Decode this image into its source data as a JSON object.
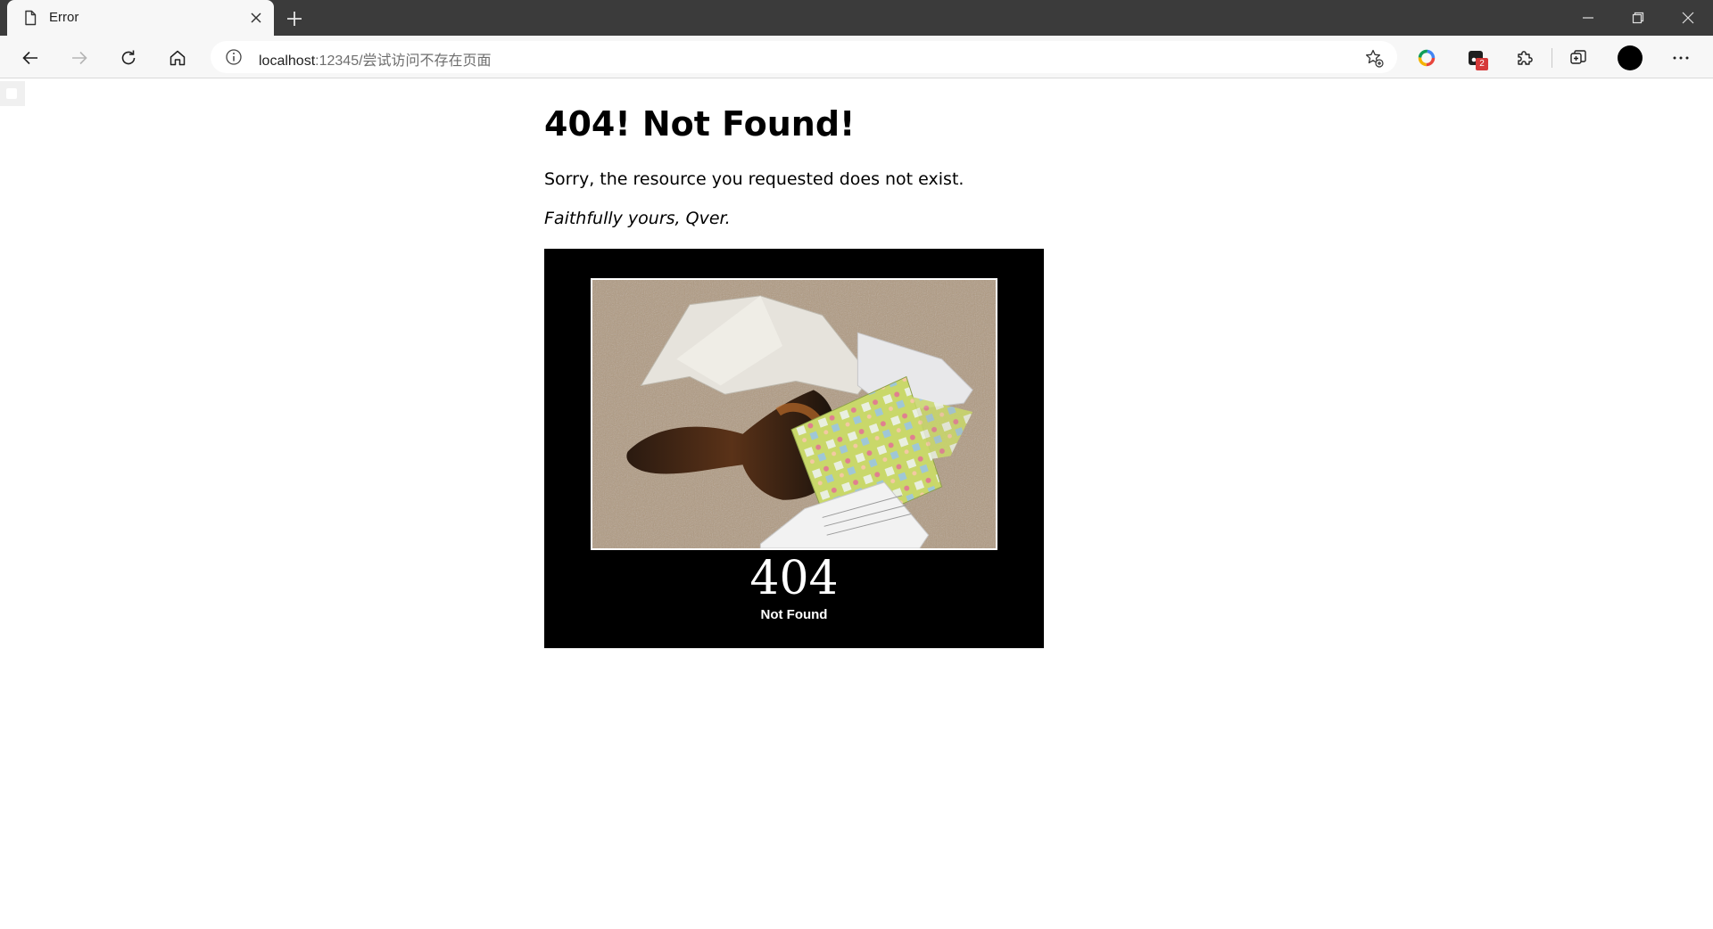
{
  "browser": {
    "tab": {
      "title": "Error",
      "favicon": "document-icon"
    },
    "address": {
      "host": "localhost",
      "path": ":12345/尝试访问不存在页面"
    },
    "extensions_badge": "2",
    "icons": {
      "back": "arrow-left-icon",
      "forward": "arrow-right-icon",
      "reload": "reload-icon",
      "home": "home-icon",
      "info": "info-icon",
      "favorites": "star-add-icon",
      "extensions": "puzzle-icon",
      "collections": "collections-icon",
      "menu": "more-icon"
    }
  },
  "page": {
    "heading": "404! Not Found!",
    "message": "Sorry, the resource you requested does not exist.",
    "signature": "Faithfully yours, Qver.",
    "poster": {
      "code": "404",
      "caption": "Not Found"
    }
  }
}
